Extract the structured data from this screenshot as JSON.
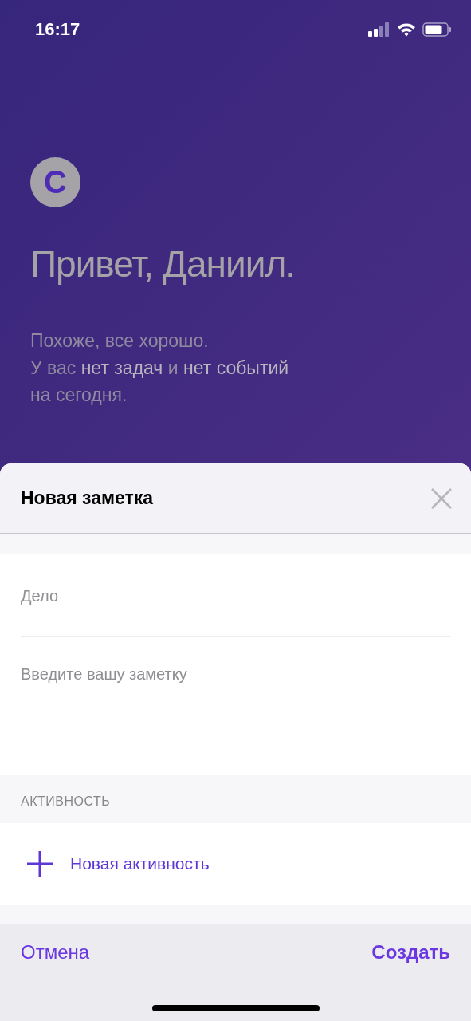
{
  "status_bar": {
    "time": "16:17"
  },
  "avatar": {
    "letter": "С"
  },
  "greeting": "Привет, Даниил.",
  "summary": [
    "Похоже, все хорошо.",
    "У вас **нет задач** и **нет событий**",
    "на сегодня."
  ],
  "sheet": {
    "title": "Новая заметка",
    "fields": [
      {
        "kind": "line",
        "placeholder": "Дело"
      },
      {
        "kind": "area",
        "placeholder": "Введите вашу заметку"
      }
    ],
    "section_header": "АКТИВНОСТЬ",
    "add_activity": {
      "label": "Новая активность"
    },
    "footer": {
      "cancel": "Отмена",
      "create": "Создать"
    }
  }
}
